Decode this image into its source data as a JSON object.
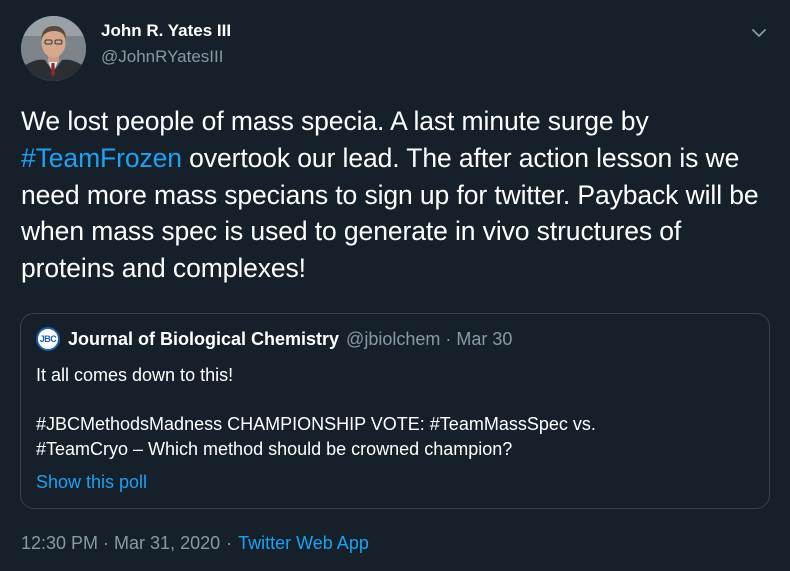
{
  "author": {
    "display_name": "John R. Yates III",
    "handle": "@JohnRYatesIII"
  },
  "tweet": {
    "text_part1": "We lost people of mass specia.  A last minute surge by ",
    "hashtag": "#TeamFrozen",
    "text_part2": " overtook our lead. The after action lesson is we need more mass specians to sign up for twitter. Payback will be when mass spec is used to generate in vivo structures of proteins and complexes!"
  },
  "quoted_tweet": {
    "logo_text": "JBC",
    "display_name": "Journal of Biological Chemistry",
    "handle": "@jbiolchem",
    "separator": "·",
    "date": "Mar 30",
    "line1": "It all comes down to this!",
    "line2": "#JBCMethodsMadness CHAMPIONSHIP VOTE: #TeamMassSpec vs.",
    "line3": "#TeamCryo – Which method should be crowned champion?",
    "show_poll_label": "Show this poll"
  },
  "footer": {
    "timestamp": "12:30 PM · Mar 31, 2020",
    "separator": "·",
    "source_app": "Twitter Web App"
  },
  "icons": {
    "avatar": "avatar-photo",
    "menu": "chevron-down-icon",
    "quoted_logo": "jbc-logo-icon"
  },
  "colors": {
    "background": "#15202b",
    "link": "#1da1f2",
    "secondary_text": "#8899a6",
    "border": "#38444d"
  }
}
